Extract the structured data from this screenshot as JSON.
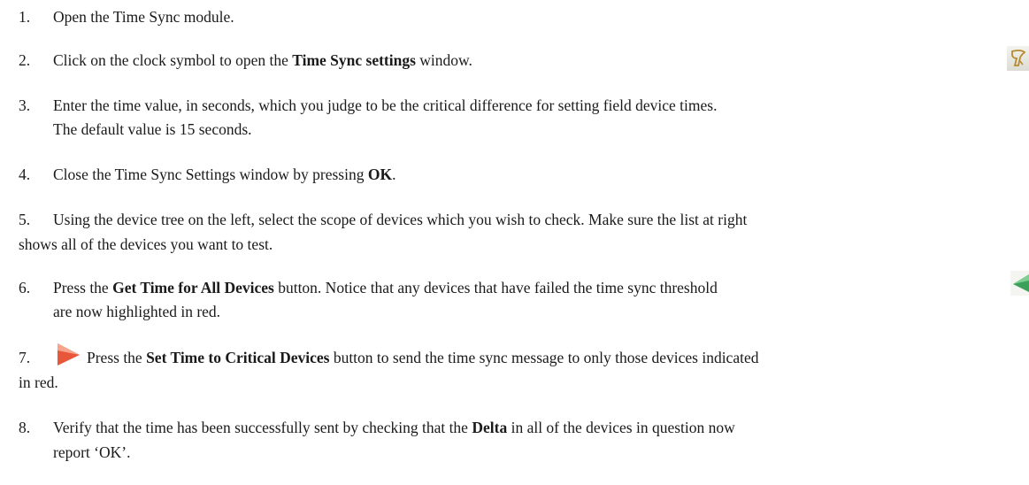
{
  "steps": [
    {
      "number": "1.",
      "parts": [
        "Open the Time Sync module."
      ]
    },
    {
      "number": "2.",
      "pre": "Click on the clock symbol to open the ",
      "bold": "Time Sync settings",
      "post": " window."
    },
    {
      "number": "3.",
      "line1": "Enter the time value, in seconds, which you judge to be the critical difference for setting field device times.",
      "line2": "The default value is 15 seconds."
    },
    {
      "number": "4.",
      "pre": "Close the Time Sync Settings window by pressing ",
      "bold": "OK",
      "post": "."
    },
    {
      "number": "5.",
      "line1": "Using the device tree on the left, select the scope of devices which you wish to check. Make sure the list at right",
      "line2": "shows all of the devices you want to test."
    },
    {
      "number": "6.",
      "pre": "Press the ",
      "bold": "Get Time for All Devices",
      "post": " button. Notice that any devices that have failed the time sync threshold",
      "line2": "are now highlighted in red."
    },
    {
      "number": "7.",
      "pre": "Press the ",
      "bold": "Set Time to Critical Devices",
      "post": " button to send the time sync message to only those devices indicated",
      "line2": "in red."
    },
    {
      "number": "8.",
      "pre": "Verify that the time has been successfully sent by checking that the ",
      "bold": "Delta",
      "post": " in all of the devices in question now",
      "line2": "report ‘OK’."
    }
  ],
  "icons": {
    "clock": "clock-icon",
    "get_time": "get-time-arrow-icon",
    "set_time": "set-time-arrow-icon",
    "get_color": "#3aa05a",
    "set_color": "#e8573a"
  }
}
